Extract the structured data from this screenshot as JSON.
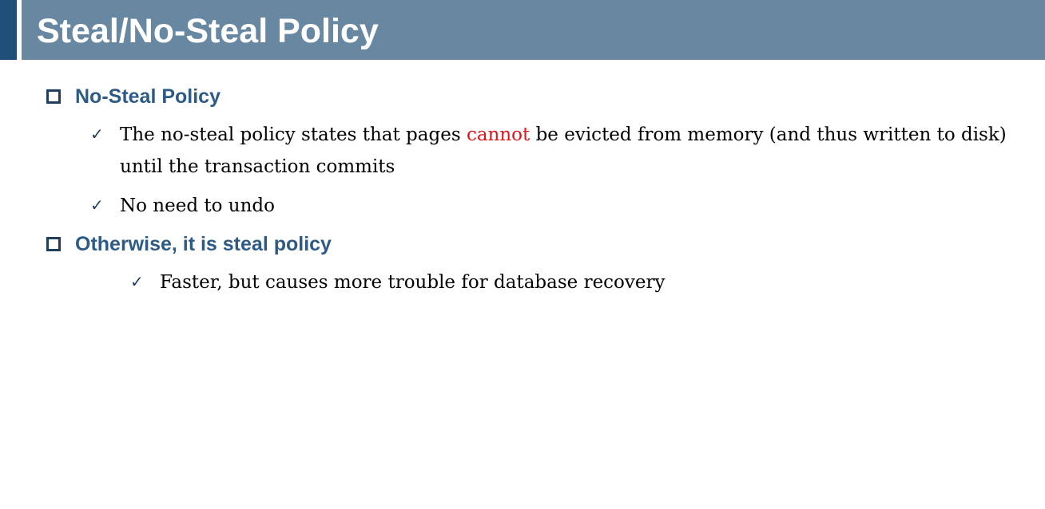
{
  "slide": {
    "title": "Steal/No-Steal Policy",
    "colors": {
      "title_bar": "#6888a2",
      "accent": "#1f4e79",
      "heading": "#2e5b86",
      "highlight": "#e0141a"
    },
    "bullets": [
      {
        "icon": "square-bullet-icon",
        "text": "No-Steal Policy",
        "subitems": [
          {
            "icon": "checkmark-icon",
            "before": "The no-steal policy states that pages",
            "highlight": "cannot",
            "after_line1": "be evicted from memory (and thus written to disk)",
            "line2": "until the transaction commits"
          },
          {
            "icon": "checkmark-icon",
            "text": "No need to undo"
          }
        ]
      },
      {
        "icon": "square-bullet-icon",
        "text": "Otherwise, it is steal policy",
        "subitems": [
          {
            "icon": "checkmark-icon",
            "text": "Faster, but causes more trouble for database recovery"
          }
        ]
      }
    ]
  }
}
